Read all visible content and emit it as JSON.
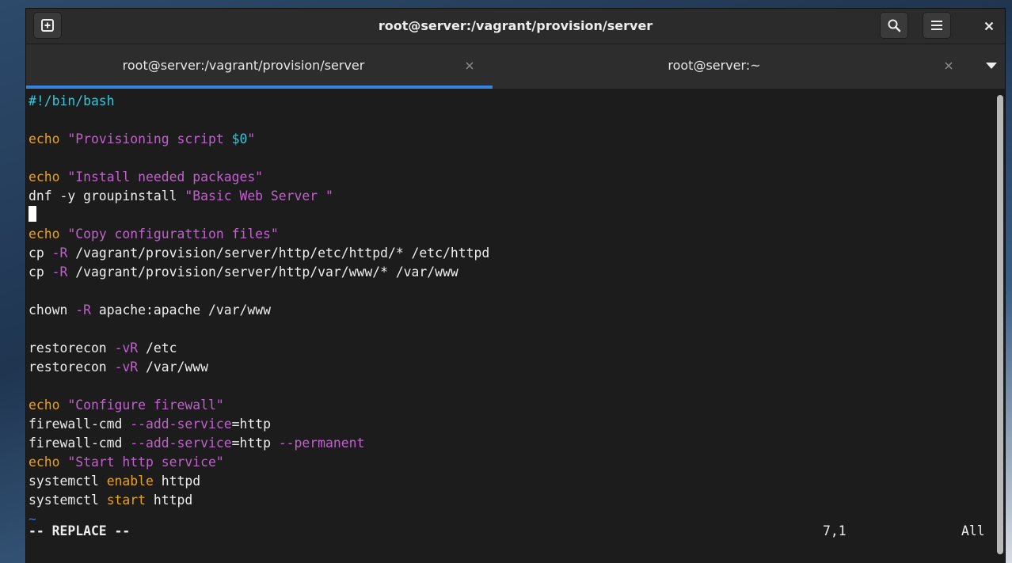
{
  "header": {
    "title": "root@server:/vagrant/provision/server",
    "new_tab_icon": "new-tab-icon",
    "search_icon": "search-icon",
    "menu_icon": "hamburger-menu-icon",
    "close_icon": "close-icon"
  },
  "tabs": [
    {
      "label": "root@server:/vagrant/provision/server",
      "active": true
    },
    {
      "label": "root@server:~",
      "active": false
    }
  ],
  "editor": {
    "lines": [
      [
        {
          "t": "#!/bin/bash",
          "c": "cyan"
        }
      ],
      [],
      [
        {
          "t": "echo",
          "c": "yellow"
        },
        {
          "t": " \"Provisioning script ",
          "c": "magenta"
        },
        {
          "t": "$0",
          "c": "cyan"
        },
        {
          "t": "\"",
          "c": "magenta"
        }
      ],
      [],
      [
        {
          "t": "echo",
          "c": "yellow"
        },
        {
          "t": " \"Install needed packages\"",
          "c": "magenta"
        }
      ],
      [
        {
          "t": "dnf -y groupinstall ",
          "c": "default"
        },
        {
          "t": "\"Basic Web Server \"",
          "c": "magenta"
        }
      ],
      [
        {
          "t": "",
          "c": "cursor"
        }
      ],
      [
        {
          "t": "echo",
          "c": "yellow"
        },
        {
          "t": " \"Copy configurattion files\"",
          "c": "magenta"
        }
      ],
      [
        {
          "t": "cp ",
          "c": "default"
        },
        {
          "t": "-R",
          "c": "magenta"
        },
        {
          "t": " /vagrant/provision/server/http/etc/httpd/* /etc/httpd",
          "c": "default"
        }
      ],
      [
        {
          "t": "cp ",
          "c": "default"
        },
        {
          "t": "-R",
          "c": "magenta"
        },
        {
          "t": " /vagrant/provision/server/http/var/www/* /var/www",
          "c": "default"
        }
      ],
      [],
      [
        {
          "t": "chown ",
          "c": "default"
        },
        {
          "t": "-R",
          "c": "magenta"
        },
        {
          "t": " apache:apache /var/www",
          "c": "default"
        }
      ],
      [],
      [
        {
          "t": "restorecon ",
          "c": "default"
        },
        {
          "t": "-vR",
          "c": "magenta"
        },
        {
          "t": " /etc",
          "c": "default"
        }
      ],
      [
        {
          "t": "restorecon ",
          "c": "default"
        },
        {
          "t": "-vR",
          "c": "magenta"
        },
        {
          "t": " /var/www",
          "c": "default"
        }
      ],
      [],
      [
        {
          "t": "echo",
          "c": "yellow"
        },
        {
          "t": " \"Configure firewall\"",
          "c": "magenta"
        }
      ],
      [
        {
          "t": "firewall-cmd ",
          "c": "default"
        },
        {
          "t": "--add-service",
          "c": "magenta"
        },
        {
          "t": "=http",
          "c": "default"
        }
      ],
      [
        {
          "t": "firewall-cmd ",
          "c": "default"
        },
        {
          "t": "--add-service",
          "c": "magenta"
        },
        {
          "t": "=http ",
          "c": "default"
        },
        {
          "t": "--permanent",
          "c": "magenta"
        }
      ],
      [
        {
          "t": "echo",
          "c": "yellow"
        },
        {
          "t": " \"Start http service\"",
          "c": "magenta"
        }
      ],
      [
        {
          "t": "systemctl ",
          "c": "default"
        },
        {
          "t": "enable",
          "c": "yellow"
        },
        {
          "t": " httpd",
          "c": "default"
        }
      ],
      [
        {
          "t": "systemctl ",
          "c": "default"
        },
        {
          "t": "start",
          "c": "yellow"
        },
        {
          "t": " httpd",
          "c": "default"
        }
      ],
      [
        {
          "t": "~",
          "c": "blue"
        }
      ]
    ],
    "status_mode": "-- REPLACE --",
    "status_position": "7,1",
    "status_scroll": "All"
  },
  "colors": {
    "cyan": "#33c7de",
    "yellow": "#e8a317",
    "magenta": "#c061cb",
    "blue": "#2a7bde",
    "default": "#ededed",
    "accent": "#3584e4"
  }
}
